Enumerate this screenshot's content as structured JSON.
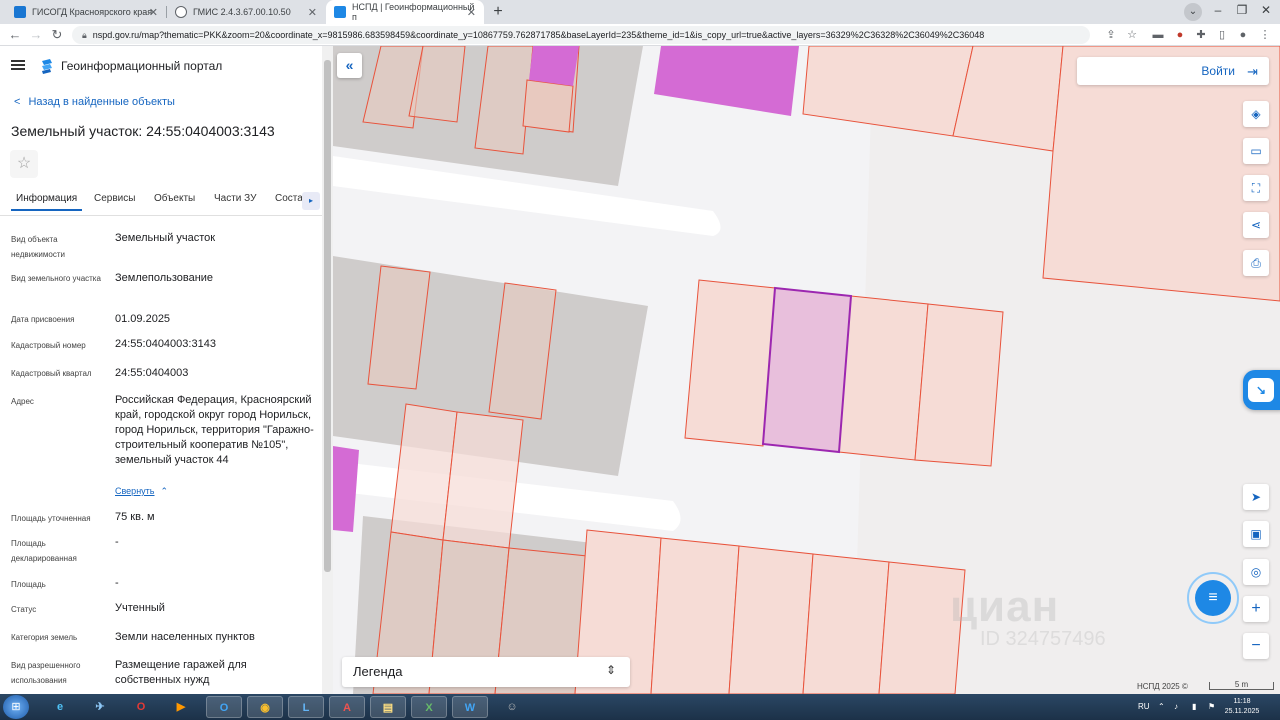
{
  "browser": {
    "tabs": [
      {
        "title": "ГИСОГД Красноярского края",
        "favicon_color": "#1976d2"
      },
      {
        "title": "ГМИС 2.4.3.67.00.10.50",
        "favicon_color": "#5f6368"
      },
      {
        "title": "НСПД | Геоинформационный п",
        "favicon_color": "#1e88e5",
        "active": true
      }
    ],
    "new_tab": "+",
    "url": "nspd.gov.ru/map?thematic=PKK&zoom=20&coordinate_x=9815986.683598459&coordinate_y=10867759.762871785&baseLayerId=235&theme_id=1&is_copy_url=true&active_layers=36329%2C36328%2C36049%2C36048"
  },
  "app": {
    "title": "Геоинформационный портал",
    "back_label": "Назад в найденные объекты",
    "object_title": "Земельный участок: 24:55:0404003:3143",
    "tabs": [
      {
        "label": "Информация",
        "active": true
      },
      {
        "label": "Сервисы"
      },
      {
        "label": "Объекты"
      },
      {
        "label": "Части ЗУ"
      },
      {
        "label": "Соста"
      }
    ],
    "fields": [
      {
        "label": "Вид объекта недвижимости",
        "value": "Земельный участок"
      },
      {
        "label": "Вид земельного участка",
        "value": "Землепользование"
      },
      {
        "label": "Дата присвоения",
        "value": "01.09.2025"
      },
      {
        "label": "Кадастровый номер",
        "value": "24:55:0404003:3143"
      },
      {
        "label": "Кадастровый квартал",
        "value": "24:55:0404003"
      },
      {
        "label": "Адрес",
        "value": "Российская Федерация, Красноярский край, городской округ город Норильск, город Норильск, территория \"Гаражно-строительный кооператив №105\", земельный участок 44"
      },
      {
        "label": "Площадь уточненная",
        "value": "75 кв. м"
      },
      {
        "label": "Площадь декларированная",
        "value": "-"
      },
      {
        "label": "Площадь",
        "value": "-"
      },
      {
        "label": "Статус",
        "value": "Учтенный"
      },
      {
        "label": "Категория земель",
        "value": "Земли населенных пунктов"
      },
      {
        "label": "Вид разрешенного использования",
        "value": "Размещение гаражей для собственных нужд"
      }
    ],
    "collapse_label": "Свернуть"
  },
  "map": {
    "login_label": "Войти",
    "legend_label": "Легенда",
    "attribution": "НСПД 2025 ©",
    "scale_label": "5 m",
    "watermark": "циан",
    "watermark_sub": "ID 324757496",
    "colors": {
      "parcel_fill": "#f6dcd6",
      "parcel_stroke": "#e8533c",
      "selected_fill": "#e8bfdc",
      "selected_stroke": "#9c27b0",
      "magenta": "#d46bd4",
      "accent": "#1565c0"
    }
  },
  "taskbar": {
    "lang": "RU",
    "time": "11:18",
    "date": "25.11.2025"
  }
}
